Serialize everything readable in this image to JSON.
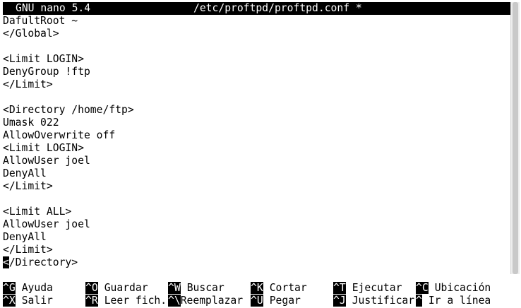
{
  "app": {
    "name": "GNU nano 5.4",
    "file_title": "/etc/proftpd/proftpd.conf *"
  },
  "editor": {
    "lines": [
      "DafultRoot ~",
      "</Global>",
      "",
      "<Limit LOGIN>",
      "DenyGroup !ftp",
      "</Limit>",
      "",
      "<Directory /home/ftp>",
      "Umask 022",
      "AllowOverwrite off",
      "<Limit LOGIN>",
      "AllowUser joel",
      "DenyAll",
      "</Limit>",
      "",
      "<Limit ALL>",
      "AllowUser joel",
      "DenyAll",
      "</Limit>",
      "</Directory>"
    ],
    "cursor_char": "<",
    "cursor_line_rest": "/Directory>"
  },
  "shortcuts": {
    "row1": [
      {
        "key": "^G",
        "label": "Ayuda"
      },
      {
        "key": "^O",
        "label": "Guardar"
      },
      {
        "key": "^W",
        "label": "Buscar"
      },
      {
        "key": "^K",
        "label": "Cortar"
      },
      {
        "key": "^T",
        "label": "Ejecutar"
      },
      {
        "key": "^C",
        "label": "Ubicación"
      }
    ],
    "row2": [
      {
        "key": "^X",
        "label": "Salir"
      },
      {
        "key": "^R",
        "label": "Leer fich."
      },
      {
        "key": "^\\",
        "label": "Reemplazar"
      },
      {
        "key": "^U",
        "label": "Pegar"
      },
      {
        "key": "^J",
        "label": "Justificar"
      },
      {
        "key": "^",
        "label": "Ir a línea"
      }
    ]
  },
  "colors": {
    "background": "#ffffff",
    "foreground": "#000000",
    "inverse_bg": "#000000",
    "inverse_fg": "#ffffff"
  }
}
